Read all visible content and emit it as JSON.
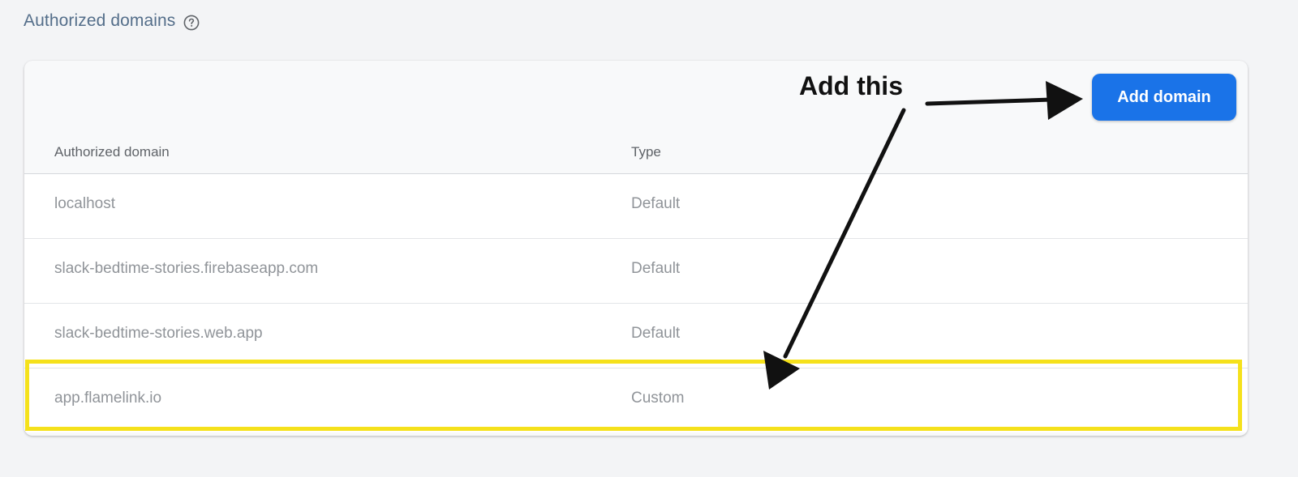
{
  "section": {
    "title": "Authorized domains",
    "help_icon": "help-circle-icon"
  },
  "toolbar": {
    "add_domain_label": "Add domain"
  },
  "table": {
    "columns": [
      "Authorized domain",
      "Type"
    ],
    "rows": [
      {
        "domain": "localhost",
        "type": "Default"
      },
      {
        "domain": "slack-bedtime-stories.firebaseapp.com",
        "type": "Default"
      },
      {
        "domain": "slack-bedtime-stories.web.app",
        "type": "Default"
      },
      {
        "domain": "app.flamelink.io",
        "type": "Custom"
      }
    ]
  },
  "annotation": {
    "label": "Add this",
    "highlight_color": "#f5e11c",
    "arrow_color": "#111111"
  },
  "colors": {
    "accent": "#1a73e8",
    "background": "#f3f4f6",
    "title_text": "#546e8a"
  }
}
